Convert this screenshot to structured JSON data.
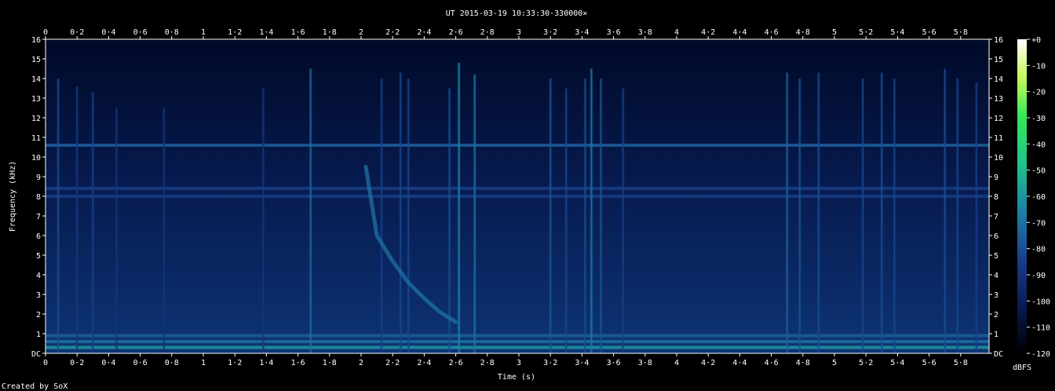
{
  "chart_data": {
    "type": "heatmap",
    "title": "UT 2015-03-19 10:33:30·330000×",
    "xlabel": "Time (s)",
    "ylabel": "Frequency (kHz)",
    "xlim": [
      0,
      5.98
    ],
    "ylim": [
      0,
      16
    ],
    "x_ticks": [
      "0",
      "0·2",
      "0·4",
      "0·6",
      "0·8",
      "1",
      "1·2",
      "1·4",
      "1·6",
      "1·8",
      "2",
      "2·2",
      "2·4",
      "2·6",
      "2·8",
      "3",
      "3·2",
      "3·4",
      "3·6",
      "3·8",
      "4",
      "4·2",
      "4·4",
      "4·6",
      "4·8",
      "5",
      "5·2",
      "5·4",
      "5·6",
      "5·8"
    ],
    "y_ticks": [
      "DC",
      "1",
      "2",
      "3",
      "4",
      "5",
      "6",
      "7",
      "8",
      "9",
      "10",
      "11",
      "12",
      "13",
      "14",
      "15",
      "16"
    ],
    "colorbar": {
      "label": "dBFS",
      "ticks": [
        "+0",
        "-10",
        "-20",
        "-30",
        "-40",
        "-50",
        "-60",
        "-70",
        "-80",
        "-90",
        "-100",
        "-110",
        "-120"
      ],
      "range": [
        -120,
        0
      ]
    },
    "background_level_dbfs": -95,
    "hum_bands_khz": [
      {
        "f": 0.3,
        "level_dbfs": -60
      },
      {
        "f": 0.6,
        "level_dbfs": -70
      },
      {
        "f": 0.9,
        "level_dbfs": -75
      },
      {
        "f": 8.0,
        "level_dbfs": -85
      },
      {
        "f": 8.4,
        "level_dbfs": -85
      },
      {
        "f": 10.6,
        "level_dbfs": -75
      }
    ],
    "impulses": [
      {
        "t": 0.08,
        "f_top": 14.0,
        "level_dbfs": -80
      },
      {
        "t": 0.2,
        "f_top": 13.6,
        "level_dbfs": -88
      },
      {
        "t": 0.3,
        "f_top": 13.3,
        "level_dbfs": -85
      },
      {
        "t": 0.45,
        "f_top": 12.5,
        "level_dbfs": -90
      },
      {
        "t": 0.75,
        "f_top": 12.5,
        "level_dbfs": -90
      },
      {
        "t": 1.38,
        "f_top": 13.5,
        "level_dbfs": -90
      },
      {
        "t": 1.68,
        "f_top": 14.5,
        "level_dbfs": -72
      },
      {
        "t": 2.13,
        "f_top": 14.0,
        "level_dbfs": -85
      },
      {
        "t": 2.25,
        "f_top": 14.3,
        "level_dbfs": -82
      },
      {
        "t": 2.3,
        "f_top": 14.0,
        "level_dbfs": -82
      },
      {
        "t": 2.56,
        "f_top": 13.5,
        "level_dbfs": -80
      },
      {
        "t": 2.62,
        "f_top": 14.8,
        "level_dbfs": -65
      },
      {
        "t": 2.72,
        "f_top": 14.2,
        "level_dbfs": -70
      },
      {
        "t": 3.2,
        "f_top": 14.0,
        "level_dbfs": -78
      },
      {
        "t": 3.3,
        "f_top": 13.5,
        "level_dbfs": -82
      },
      {
        "t": 3.42,
        "f_top": 14.0,
        "level_dbfs": -80
      },
      {
        "t": 3.46,
        "f_top": 14.5,
        "level_dbfs": -68
      },
      {
        "t": 3.52,
        "f_top": 14.0,
        "level_dbfs": -78
      },
      {
        "t": 3.66,
        "f_top": 13.5,
        "level_dbfs": -85
      },
      {
        "t": 4.7,
        "f_top": 14.3,
        "level_dbfs": -75
      },
      {
        "t": 4.78,
        "f_top": 14.0,
        "level_dbfs": -78
      },
      {
        "t": 4.9,
        "f_top": 14.3,
        "level_dbfs": -80
      },
      {
        "t": 5.18,
        "f_top": 14.0,
        "level_dbfs": -82
      },
      {
        "t": 5.3,
        "f_top": 14.3,
        "level_dbfs": -80
      },
      {
        "t": 5.38,
        "f_top": 14.0,
        "level_dbfs": -82
      },
      {
        "t": 5.7,
        "f_top": 14.5,
        "level_dbfs": -80
      },
      {
        "t": 5.78,
        "f_top": 14.0,
        "level_dbfs": -82
      },
      {
        "t": 5.9,
        "f_top": 13.8,
        "level_dbfs": -85
      }
    ],
    "whistler": {
      "points": [
        [
          2.03,
          9.5
        ],
        [
          2.1,
          6.0
        ],
        [
          2.2,
          4.7
        ],
        [
          2.3,
          3.6
        ],
        [
          2.4,
          2.8
        ],
        [
          2.5,
          2.1
        ],
        [
          2.6,
          1.6
        ]
      ],
      "level_dbfs": -70
    },
    "grid": false
  },
  "footer": {
    "credit": "Created by SoX"
  },
  "colors": {
    "background": "#000000",
    "plot_low": "#000a30",
    "plot_mid": "#0b3870",
    "plot_high": "#22c88a",
    "text": "#ffffff"
  }
}
